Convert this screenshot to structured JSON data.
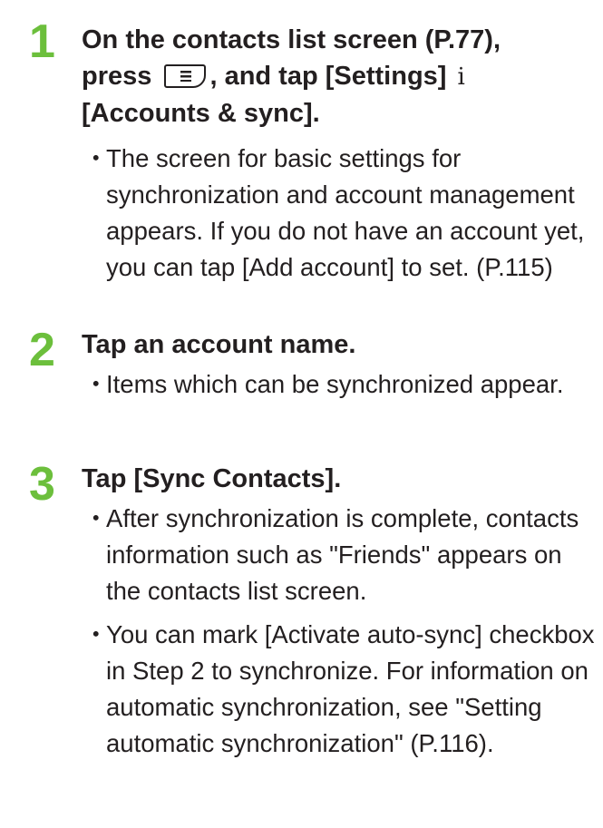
{
  "steps": [
    {
      "number": "1",
      "heading": {
        "part1": "On the contacts list screen (P.77),",
        "part2": "press",
        "part3": ", and tap [Settings]",
        "arrow": "i",
        "part4": "[Accounts & sync]."
      },
      "bullets": [
        "The screen for basic settings for synchronization and account management appears. If you do not have an account yet, you can tap [Add account] to set. (P.115)"
      ]
    },
    {
      "number": "2",
      "heading": {
        "text": "Tap an account name."
      },
      "bullets": [
        "Items which can be synchronized appear."
      ]
    },
    {
      "number": "3",
      "heading": {
        "text": "Tap [Sync Contacts]."
      },
      "bullets": [
        "After synchronization is complete, contacts information such as \"Friends\" appears on the contacts list screen.",
        "You can mark [Activate auto-sync] checkbox in Step 2 to synchronize. For information on automatic synchronization, see \"Setting automatic synchronization\" (P.116)."
      ]
    }
  ],
  "bullet_symbol": "・",
  "icons": {
    "menu_key": "menu-key-icon"
  },
  "colors": {
    "step_number": "#6cbf3c",
    "text": "#231f20"
  }
}
